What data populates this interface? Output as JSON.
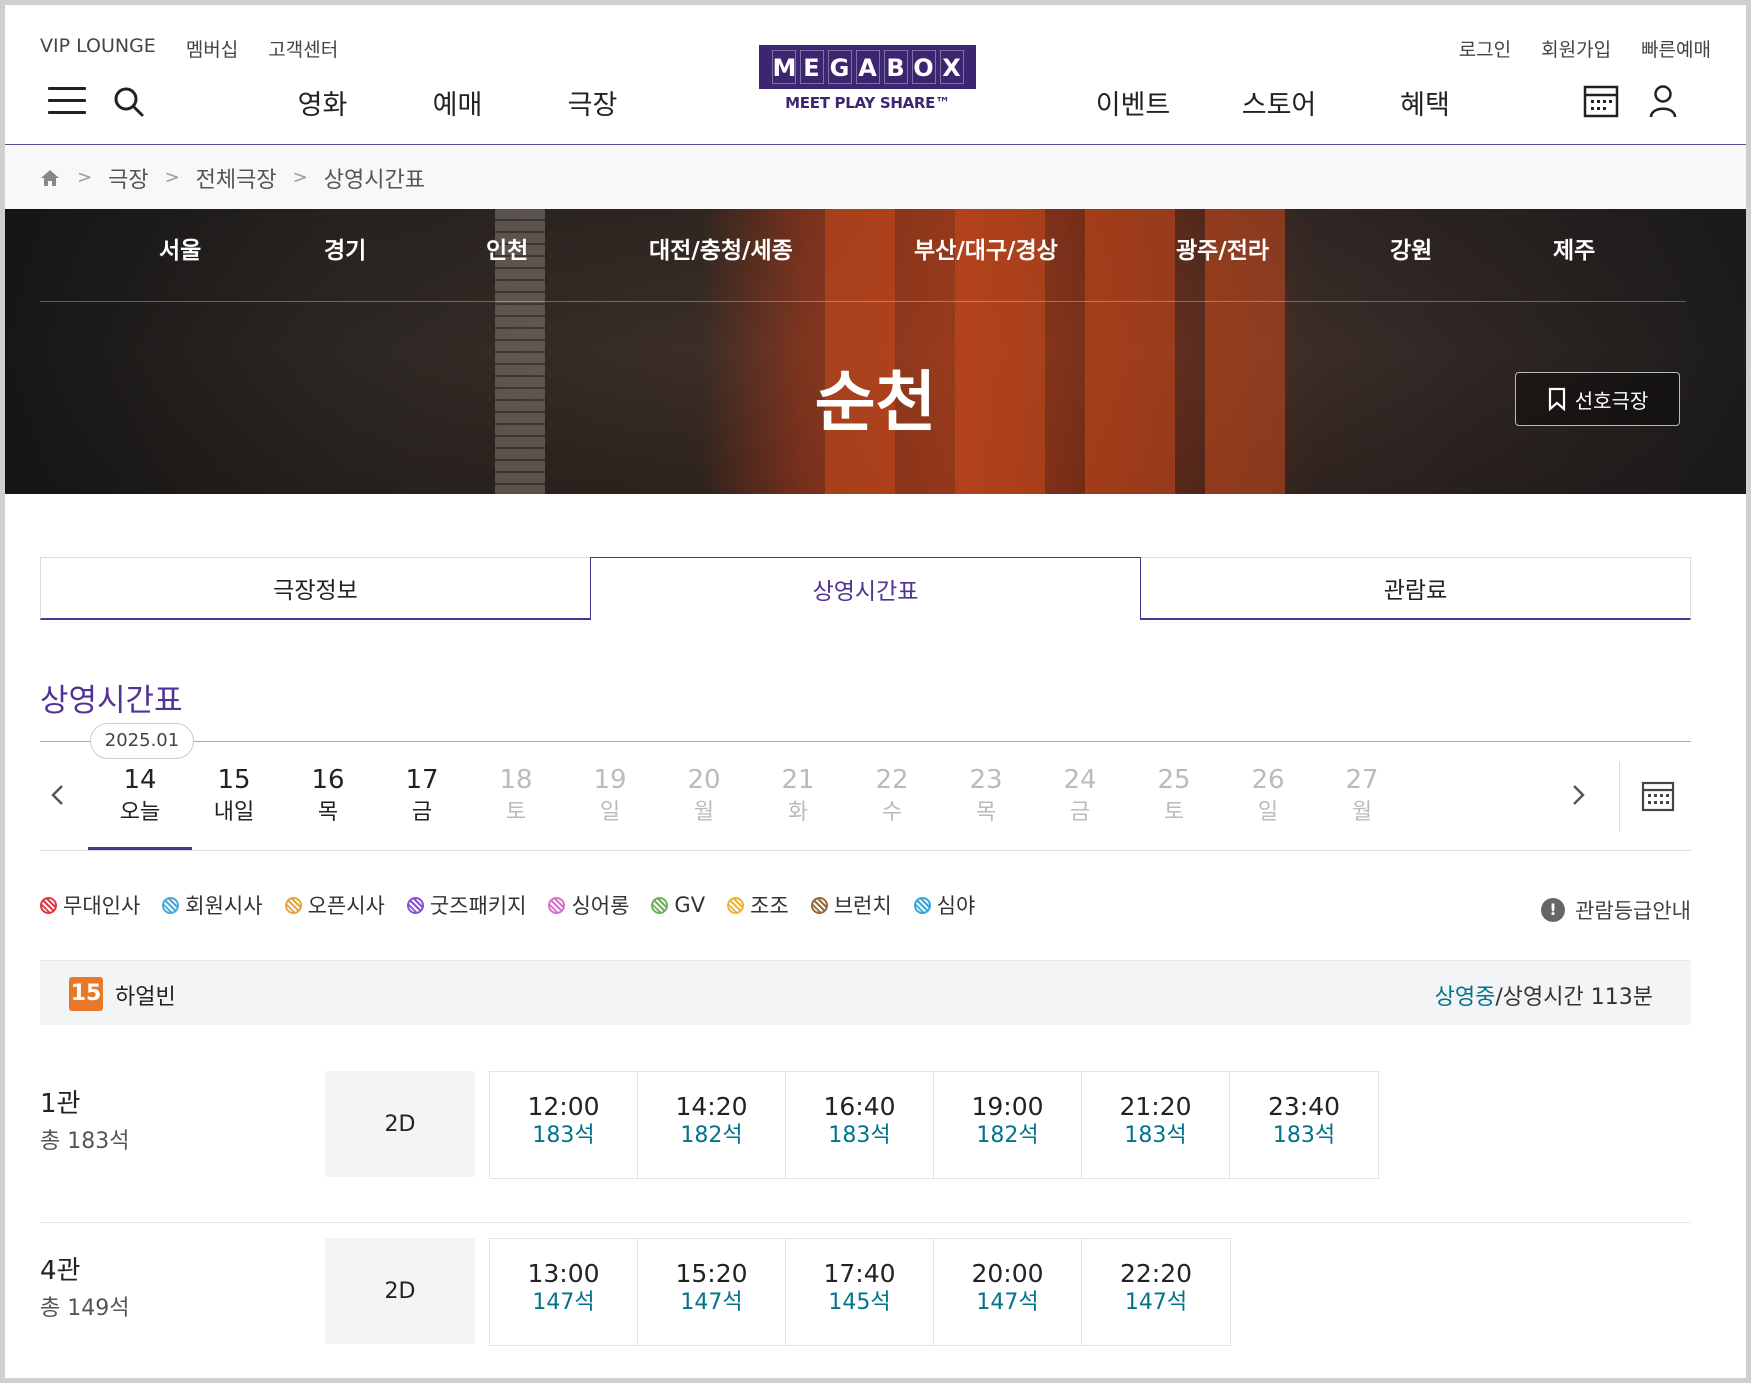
{
  "header": {
    "util_left": [
      "VIP LOUNGE",
      "멤버십",
      "고객센터"
    ],
    "util_right": [
      "로그인",
      "회원가입",
      "빠른예매"
    ],
    "nav_left": [
      "영화",
      "예매",
      "극장"
    ],
    "nav_right": [
      "이벤트",
      "스토어",
      "혜택"
    ],
    "logo": {
      "letters": [
        "M",
        "E",
        "G",
        "A",
        "B",
        "O",
        "X"
      ],
      "tagline": "MEET PLAY SHARE™"
    },
    "icons": [
      "menu-icon",
      "search-icon",
      "schedule-icon",
      "user-icon"
    ]
  },
  "breadcrumb": [
    "극장",
    "전체극장",
    "상영시간표"
  ],
  "hero": {
    "regions": [
      "서울",
      "경기",
      "인천",
      "대전/충청/세종",
      "부산/대구/경상",
      "광주/전라",
      "강원",
      "제주"
    ],
    "theater_name": "순천",
    "favorite_label": "선호극장"
  },
  "tabs": [
    {
      "label": "극장정보",
      "active": false
    },
    {
      "label": "상영시간표",
      "active": true
    },
    {
      "label": "관람료",
      "active": false
    }
  ],
  "schedule": {
    "title": "상영시간표",
    "year_month": "2025.01",
    "dates": [
      {
        "day": "14",
        "label": "오늘",
        "disabled": false,
        "selected": true
      },
      {
        "day": "15",
        "label": "내일",
        "disabled": false,
        "selected": false
      },
      {
        "day": "16",
        "label": "목",
        "disabled": false,
        "selected": false
      },
      {
        "day": "17",
        "label": "금",
        "disabled": false,
        "selected": false
      },
      {
        "day": "18",
        "label": "토",
        "disabled": true,
        "selected": false
      },
      {
        "day": "19",
        "label": "일",
        "disabled": true,
        "selected": false
      },
      {
        "day": "20",
        "label": "월",
        "disabled": true,
        "selected": false
      },
      {
        "day": "21",
        "label": "화",
        "disabled": true,
        "selected": false
      },
      {
        "day": "22",
        "label": "수",
        "disabled": true,
        "selected": false
      },
      {
        "day": "23",
        "label": "목",
        "disabled": true,
        "selected": false
      },
      {
        "day": "24",
        "label": "금",
        "disabled": true,
        "selected": false
      },
      {
        "day": "25",
        "label": "토",
        "disabled": true,
        "selected": false
      },
      {
        "day": "26",
        "label": "일",
        "disabled": true,
        "selected": false
      },
      {
        "day": "27",
        "label": "월",
        "disabled": true,
        "selected": false
      }
    ]
  },
  "legend": [
    {
      "label": "무대인사",
      "color": "#e0393e",
      "icon": "stage-greeting-icon"
    },
    {
      "label": "회원시사",
      "color": "#4aa8d8",
      "icon": "member-preview-icon"
    },
    {
      "label": "오픈시사",
      "color": "#e8a33a",
      "icon": "open-preview-icon"
    },
    {
      "label": "굿즈패키지",
      "color": "#8c4fd8",
      "icon": "goods-package-icon"
    },
    {
      "label": "싱어롱",
      "color": "#d86fc8",
      "icon": "singalong-icon"
    },
    {
      "label": "GV",
      "color": "#6bb35a",
      "icon": "gv-icon"
    },
    {
      "label": "조조",
      "color": "#f0b428",
      "icon": "morning-sun-icon"
    },
    {
      "label": "브런치",
      "color": "#9a6a3a",
      "icon": "brunch-cup-icon"
    },
    {
      "label": "심야",
      "color": "#36a6d8",
      "icon": "late-night-moon-icon"
    }
  ],
  "rating_guide": "관람등급안내",
  "movie": {
    "age": "15",
    "title": "하얼빈",
    "status": "상영중",
    "runtime": "/상영시간 113분"
  },
  "halls": [
    {
      "name": "1관",
      "seats": "총 183석",
      "type": "2D",
      "slots": [
        {
          "time": "12:00",
          "seats": "183석"
        },
        {
          "time": "14:20",
          "seats": "182석"
        },
        {
          "time": "16:40",
          "seats": "183석"
        },
        {
          "time": "19:00",
          "seats": "182석"
        },
        {
          "time": "21:20",
          "seats": "183석"
        },
        {
          "time": "23:40",
          "seats": "183석"
        }
      ]
    },
    {
      "name": "4관",
      "seats": "총 149석",
      "type": "2D",
      "slots": [
        {
          "time": "13:00",
          "seats": "147석"
        },
        {
          "time": "15:20",
          "seats": "147석"
        },
        {
          "time": "17:40",
          "seats": "145석"
        },
        {
          "time": "20:00",
          "seats": "147석"
        },
        {
          "time": "22:20",
          "seats": "147석"
        }
      ]
    }
  ]
}
